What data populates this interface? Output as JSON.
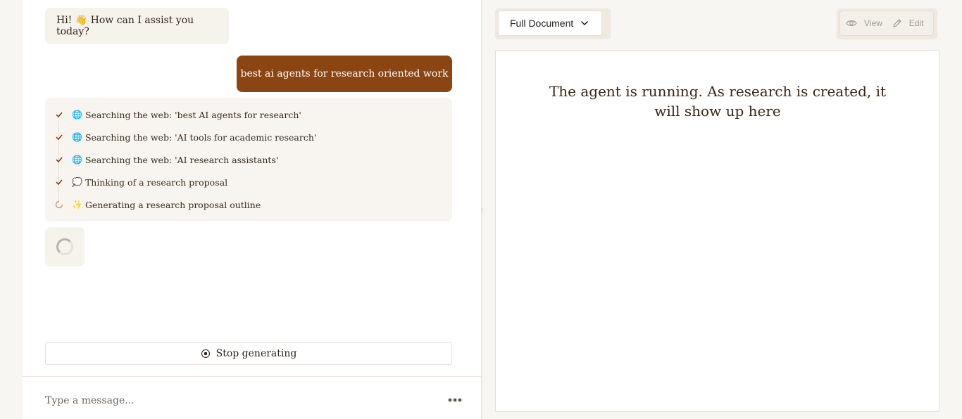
{
  "chat": {
    "greeting": "Hi! 👋 How can I assist you today?",
    "user_message": "best ai agents for research oriented work",
    "steps": [
      {
        "icon": "🌐",
        "label": "Searching the web: 'best AI agents for research'",
        "status": "done"
      },
      {
        "icon": "🌐",
        "label": "Searching the web: 'AI tools for academic research'",
        "status": "done"
      },
      {
        "icon": "🌐",
        "label": "Searching the web: 'AI research assistants'",
        "status": "done"
      },
      {
        "icon": "💭",
        "label": "Thinking of a research proposal",
        "status": "done"
      },
      {
        "icon": "✨",
        "label": "Generating a research proposal outline",
        "status": "in-progress"
      }
    ],
    "stop_label": "Stop generating",
    "composer_placeholder": "Type a message..."
  },
  "document": {
    "view_select": "Full Document",
    "mode_view": "View",
    "mode_edit": "Edit",
    "placeholder_message": "The agent is running. As research is created, it will show up here"
  },
  "colors": {
    "accent": "#8b4513",
    "check": "#8b2e0a",
    "background": "#f8f6f2"
  }
}
